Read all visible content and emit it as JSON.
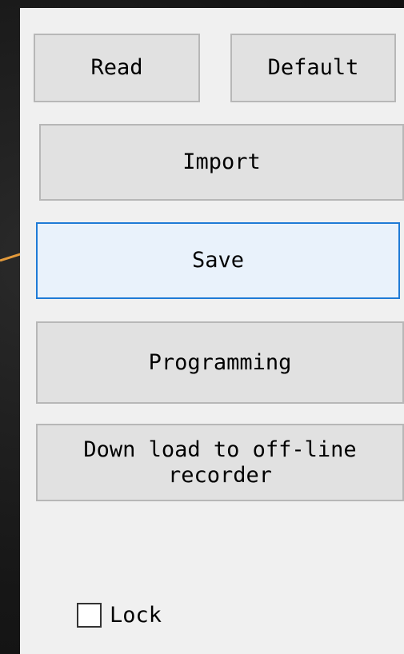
{
  "colors": {
    "panel_background": "#f0f0f0",
    "button_face": "#e1e1e1",
    "button_border": "#b7b7b7",
    "focus_border": "#1f7bd6",
    "pointer_line": "#e39a3b"
  },
  "buttons": {
    "read": "Read",
    "default": "Default",
    "import": "Import",
    "save": "Save",
    "programming": "Programming",
    "download": "Down load to off-line\nrecorder"
  },
  "lock": {
    "label": "Lock",
    "checked": false
  }
}
